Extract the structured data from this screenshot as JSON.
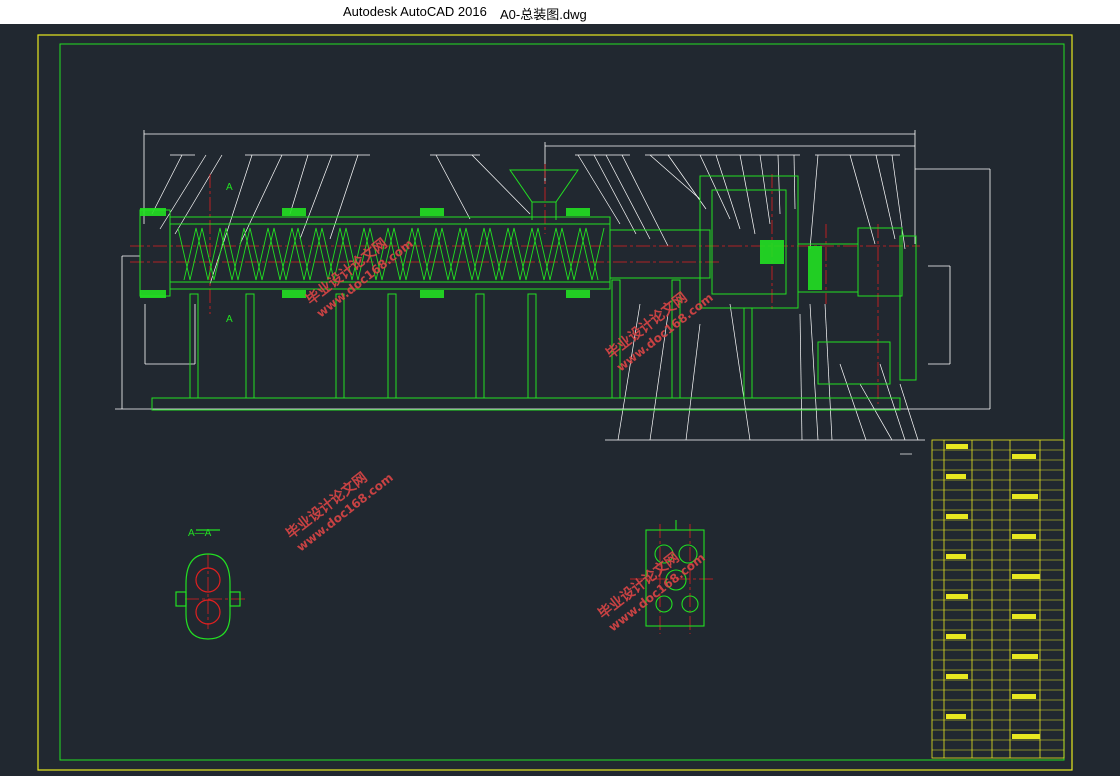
{
  "window": {
    "app_title": "Autodesk AutoCAD 2016",
    "file_name": "A0-总装图.dwg"
  },
  "drawing": {
    "section_label": "A—A",
    "section_mark_top": "A",
    "section_mark_bottom": "A"
  },
  "watermarks": [
    {
      "text": "毕业设计论文网",
      "sub": "www.doc168.com"
    },
    {
      "text": "毕业设计论文网",
      "sub": "www.doc168.com"
    },
    {
      "text": "毕业设计论文网",
      "sub": "www.doc168.com"
    },
    {
      "text": "毕业设计论文网",
      "sub": "www.doc168.com"
    }
  ],
  "colors": {
    "background": "#212830",
    "frame": "#e8e820",
    "geometry": "#22e022",
    "centerline": "#e02020",
    "dimension": "#ffffff",
    "watermark": "#e04646"
  }
}
